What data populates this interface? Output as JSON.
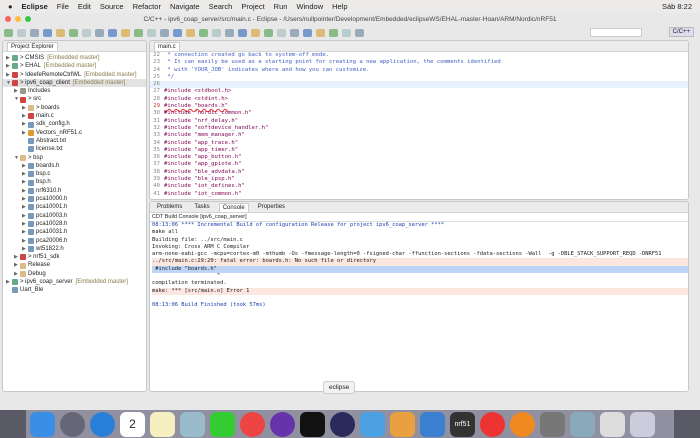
{
  "menubar": {
    "apple": "",
    "items": [
      "Eclipse",
      "File",
      "Edit",
      "Source",
      "Refactor",
      "Navigate",
      "Search",
      "Project",
      "Run",
      "Window",
      "Help"
    ],
    "clock": "Sáb 8:22"
  },
  "window": {
    "title": "C/C++ - ipv6_coap_server/src/main.c - Eclipse - /Users/nullpointer/Development/Embedded/eclipseWS/EHAL-master-Hoan/ARM/Nordic/nRF51",
    "perspective": "C/C++"
  },
  "explorer": {
    "tab": "Project Explorer",
    "rows": [
      {
        "d": 0,
        "a": "▶",
        "t": "> CMSIS",
        "m": "[Embedded master]",
        "c": "#6a8"
      },
      {
        "d": 0,
        "a": "▶",
        "t": "> EHAL",
        "m": "[Embedded master]",
        "c": "#6a8"
      },
      {
        "d": 0,
        "a": "▶",
        "t": "> IdeefeRemoteCtrlWL",
        "m": "[Embedded master]",
        "c": "#c44"
      },
      {
        "d": 0,
        "a": "▼",
        "t": "> ipv6_coap_client",
        "m": "[Embedded master]",
        "c": "#c44",
        "sel": true
      },
      {
        "d": 1,
        "a": "▶",
        "t": "Includes",
        "c": "#998"
      },
      {
        "d": 1,
        "a": "▼",
        "t": "> src",
        "c": "#c44"
      },
      {
        "d": 2,
        "a": "▶",
        "t": "> boards",
        "c": "#db8"
      },
      {
        "d": 2,
        "a": "▶",
        "t": "main.c",
        "c": "#c44"
      },
      {
        "d": 2,
        "a": "▶",
        "t": "sdk_config.h",
        "c": "#79b"
      },
      {
        "d": 2,
        "a": "▶",
        "t": "Vectors_nRF51.c",
        "c": "#d93"
      },
      {
        "d": 2,
        "a": "",
        "t": "Abstract.txt",
        "c": "#79b"
      },
      {
        "d": 2,
        "a": "",
        "t": "license.txt",
        "c": "#79b"
      },
      {
        "d": 1,
        "a": "▼",
        "t": "> bsp",
        "c": "#db8"
      },
      {
        "d": 2,
        "a": "▶",
        "t": "boards.h",
        "c": "#79b"
      },
      {
        "d": 2,
        "a": "▶",
        "t": "bsp.c",
        "c": "#79b"
      },
      {
        "d": 2,
        "a": "▶",
        "t": "bsp.h",
        "c": "#79b"
      },
      {
        "d": 2,
        "a": "▶",
        "t": "nrf6310.h",
        "c": "#79b"
      },
      {
        "d": 2,
        "a": "▶",
        "t": "pca10000.h",
        "c": "#79b"
      },
      {
        "d": 2,
        "a": "▶",
        "t": "pca10001.h",
        "c": "#79b"
      },
      {
        "d": 2,
        "a": "▶",
        "t": "pca10003.h",
        "c": "#79b"
      },
      {
        "d": 2,
        "a": "▶",
        "t": "pca10028.h",
        "c": "#79b"
      },
      {
        "d": 2,
        "a": "▶",
        "t": "pca10031.h",
        "c": "#79b"
      },
      {
        "d": 2,
        "a": "▶",
        "t": "pca20006.h",
        "c": "#79b"
      },
      {
        "d": 2,
        "a": "▶",
        "t": "wt51822.h",
        "c": "#79b"
      },
      {
        "d": 1,
        "a": "▶",
        "t": "> nrf51_sdk",
        "c": "#c44"
      },
      {
        "d": 1,
        "a": "▶",
        "t": "Release",
        "c": "#db8"
      },
      {
        "d": 1,
        "a": "▶",
        "t": "Debug",
        "c": "#db8"
      },
      {
        "d": 0,
        "a": "▶",
        "t": "> ipv6_coap_server",
        "m": "[Embedded master]",
        "c": "#6a8"
      },
      {
        "d": 0,
        "a": "",
        "t": "Uart_Ble",
        "c": "#79b"
      }
    ]
  },
  "editor": {
    "tab": "main.c",
    "lines": [
      {
        "n": "22",
        "t": " * connection created go back to system-off mode.",
        "k": "cm"
      },
      {
        "n": "23",
        "t": " * It can easily be used as a starting point for creating a new application, the comments identified",
        "k": "cm"
      },
      {
        "n": "24",
        "t": " * with 'YOUR_JOB' indicates where and how you can customize.",
        "k": "cm"
      },
      {
        "n": "25",
        "t": " */",
        "k": "cm"
      },
      {
        "n": "26",
        "t": "",
        "k": "cur"
      },
      {
        "n": "27",
        "t": "#include <stdbool.h>",
        "k": "inc"
      },
      {
        "n": "28",
        "t": "#include <stdint.h>",
        "k": "inc"
      },
      {
        "n": "29",
        "t": "#include \"boards.h\"",
        "k": "err"
      },
      {
        "n": "30",
        "t": "#include \"nordic_common.h\"",
        "k": "inc"
      },
      {
        "n": "31",
        "t": "#include \"nrf_delay.h\"",
        "k": "inc"
      },
      {
        "n": "32",
        "t": "#include \"softdevice_handler.h\"",
        "k": "inc"
      },
      {
        "n": "33",
        "t": "#include \"mem_manager.h\"",
        "k": "inc"
      },
      {
        "n": "34",
        "t": "#include \"app_trace.h\"",
        "k": "inc"
      },
      {
        "n": "35",
        "t": "#include \"app_timer.h\"",
        "k": "inc"
      },
      {
        "n": "36",
        "t": "#include \"app_button.h\"",
        "k": "inc"
      },
      {
        "n": "37",
        "t": "#include \"app_gpiote.h\"",
        "k": "inc"
      },
      {
        "n": "38",
        "t": "#include \"ble_advdata.h\"",
        "k": "inc"
      },
      {
        "n": "39",
        "t": "#include \"ble_ipsp.h\"",
        "k": "inc"
      },
      {
        "n": "40",
        "t": "#include \"iot_defines.h\"",
        "k": "inc"
      },
      {
        "n": "41",
        "t": "#include \"iot_common.h\"",
        "k": "inc"
      }
    ]
  },
  "console": {
    "tabs": [
      "Problems",
      "Tasks",
      "Console",
      "Properties"
    ],
    "active": 2,
    "heading": "CDT Build Console [ipv6_coap_server]",
    "lines": [
      {
        "t": "08:13:06 **** Incremental Build of configuration Release for project ipv6_coap_server ****",
        "k": "blue"
      },
      {
        "t": "make all",
        "k": ""
      },
      {
        "t": "Building file: ../src/main.c",
        "k": ""
      },
      {
        "t": "Invoking: Cross ARM C Compiler",
        "k": ""
      },
      {
        "t": "arm-none-eabi-gcc -mcpu=cortex-m0 -mthumb -Os -fmessage-length=0 -fsigned-char -ffunction-sections -fdata-sections -Wall  -g -DBLE_STACK_SUPPORT_REQD -DNRF51",
        "k": ""
      },
      {
        "t": "../src/main.c:29:20: fatal error: boards.h: No such file or directory",
        "k": "errbg"
      },
      {
        "t": " #include \"boards.h\"",
        "k": "hl"
      },
      {
        "t": "                    ^",
        "k": ""
      },
      {
        "t": "compilation terminated.",
        "k": ""
      },
      {
        "t": "make: *** [src/main.o] Error 1",
        "k": "errbg"
      },
      {
        "t": "",
        "k": ""
      },
      {
        "t": "08:13:06 Build Finished (took 57ms)",
        "k": "blue"
      }
    ]
  },
  "dock": {
    "tooltip": "eclipse",
    "apps": [
      {
        "name": "finder",
        "c": "#3a8ee6"
      },
      {
        "name": "launchpad",
        "c": "#667"
      },
      {
        "name": "safari",
        "c": "#2a7fd8"
      },
      {
        "name": "calendar",
        "c": "#fff",
        "label": "2"
      },
      {
        "name": "notes",
        "c": "#f6f0c0"
      },
      {
        "name": "preview",
        "c": "#9bc"
      },
      {
        "name": "facetime",
        "c": "#3c3"
      },
      {
        "name": "chrome",
        "c": "#e44"
      },
      {
        "name": "github",
        "c": "#63a"
      },
      {
        "name": "terminal",
        "c": "#111"
      },
      {
        "name": "eclipse",
        "c": "#2c2a5a"
      },
      {
        "name": "xcode",
        "c": "#4aa0e0"
      },
      {
        "name": "pages",
        "c": "#e8a040"
      },
      {
        "name": "keynote",
        "c": "#3a7fd0"
      },
      {
        "name": "nrf51",
        "c": "#333",
        "label": "nrf51"
      },
      {
        "name": "itunes",
        "c": "#e33"
      },
      {
        "name": "ibooks",
        "c": "#f08a20"
      },
      {
        "name": "system-preferences",
        "c": "#777"
      },
      {
        "name": "photos",
        "c": "#8ab"
      },
      {
        "name": "downloads",
        "c": "#ddd"
      },
      {
        "name": "trash",
        "c": "#ccd"
      }
    ]
  }
}
